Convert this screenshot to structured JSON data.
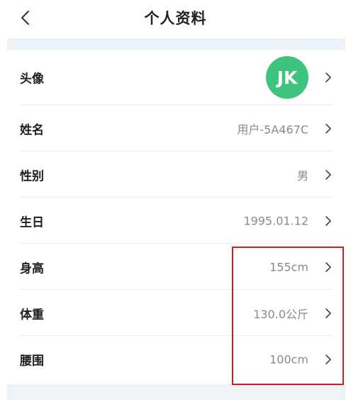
{
  "header": {
    "title": "个人资料",
    "back_icon": "chevron-left-icon"
  },
  "profile": {
    "avatar": {
      "label": "头像",
      "initials": "JK",
      "color": "#3fc47f"
    },
    "name": {
      "label": "姓名",
      "value": "用户-5A467C"
    },
    "gender": {
      "label": "性别",
      "value": "男"
    },
    "birthday": {
      "label": "生日",
      "value": "1995.01.12"
    },
    "height": {
      "label": "身高",
      "value": "155cm"
    },
    "weight": {
      "label": "体重",
      "value": "130.0公斤"
    },
    "waist": {
      "label": "腰围",
      "value": "100cm"
    }
  },
  "colors": {
    "accent_avatar": "#3fc47f",
    "band_background": "#eef3f8",
    "highlight_border": "#cc2020",
    "value_text": "#8a8a8a",
    "label_text": "#1f1f1f"
  },
  "icons": {
    "row_chevron": "chevron-right-icon"
  }
}
